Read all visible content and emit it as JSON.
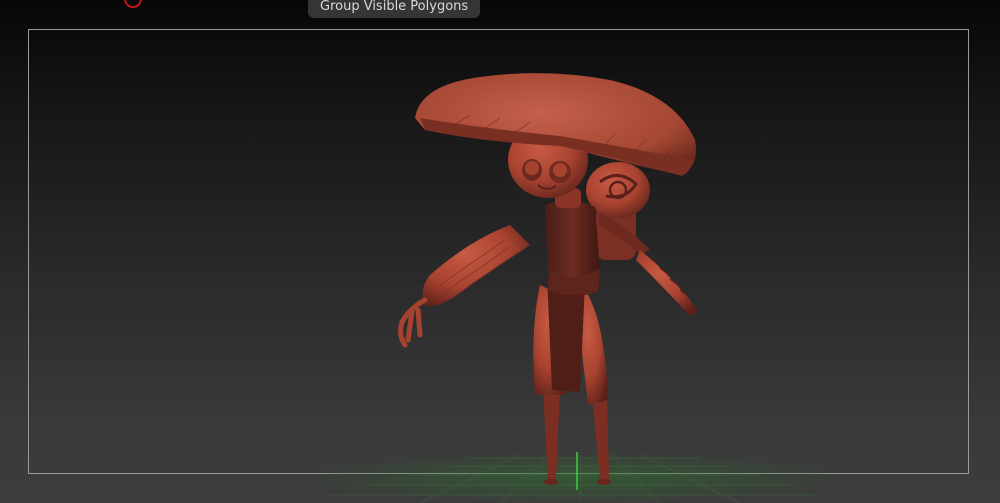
{
  "tooltip": {
    "text": "Group Visible Polygons"
  },
  "colors": {
    "model_base": "#b24a37",
    "model_shadow": "#5a2019",
    "floor_grid": "#2f6a2f",
    "frame_border": "#9a9a9a",
    "record_indicator": "#c0141a"
  },
  "icons": {
    "record": "record-indicator-icon",
    "axis": "green-axis-icon"
  }
}
